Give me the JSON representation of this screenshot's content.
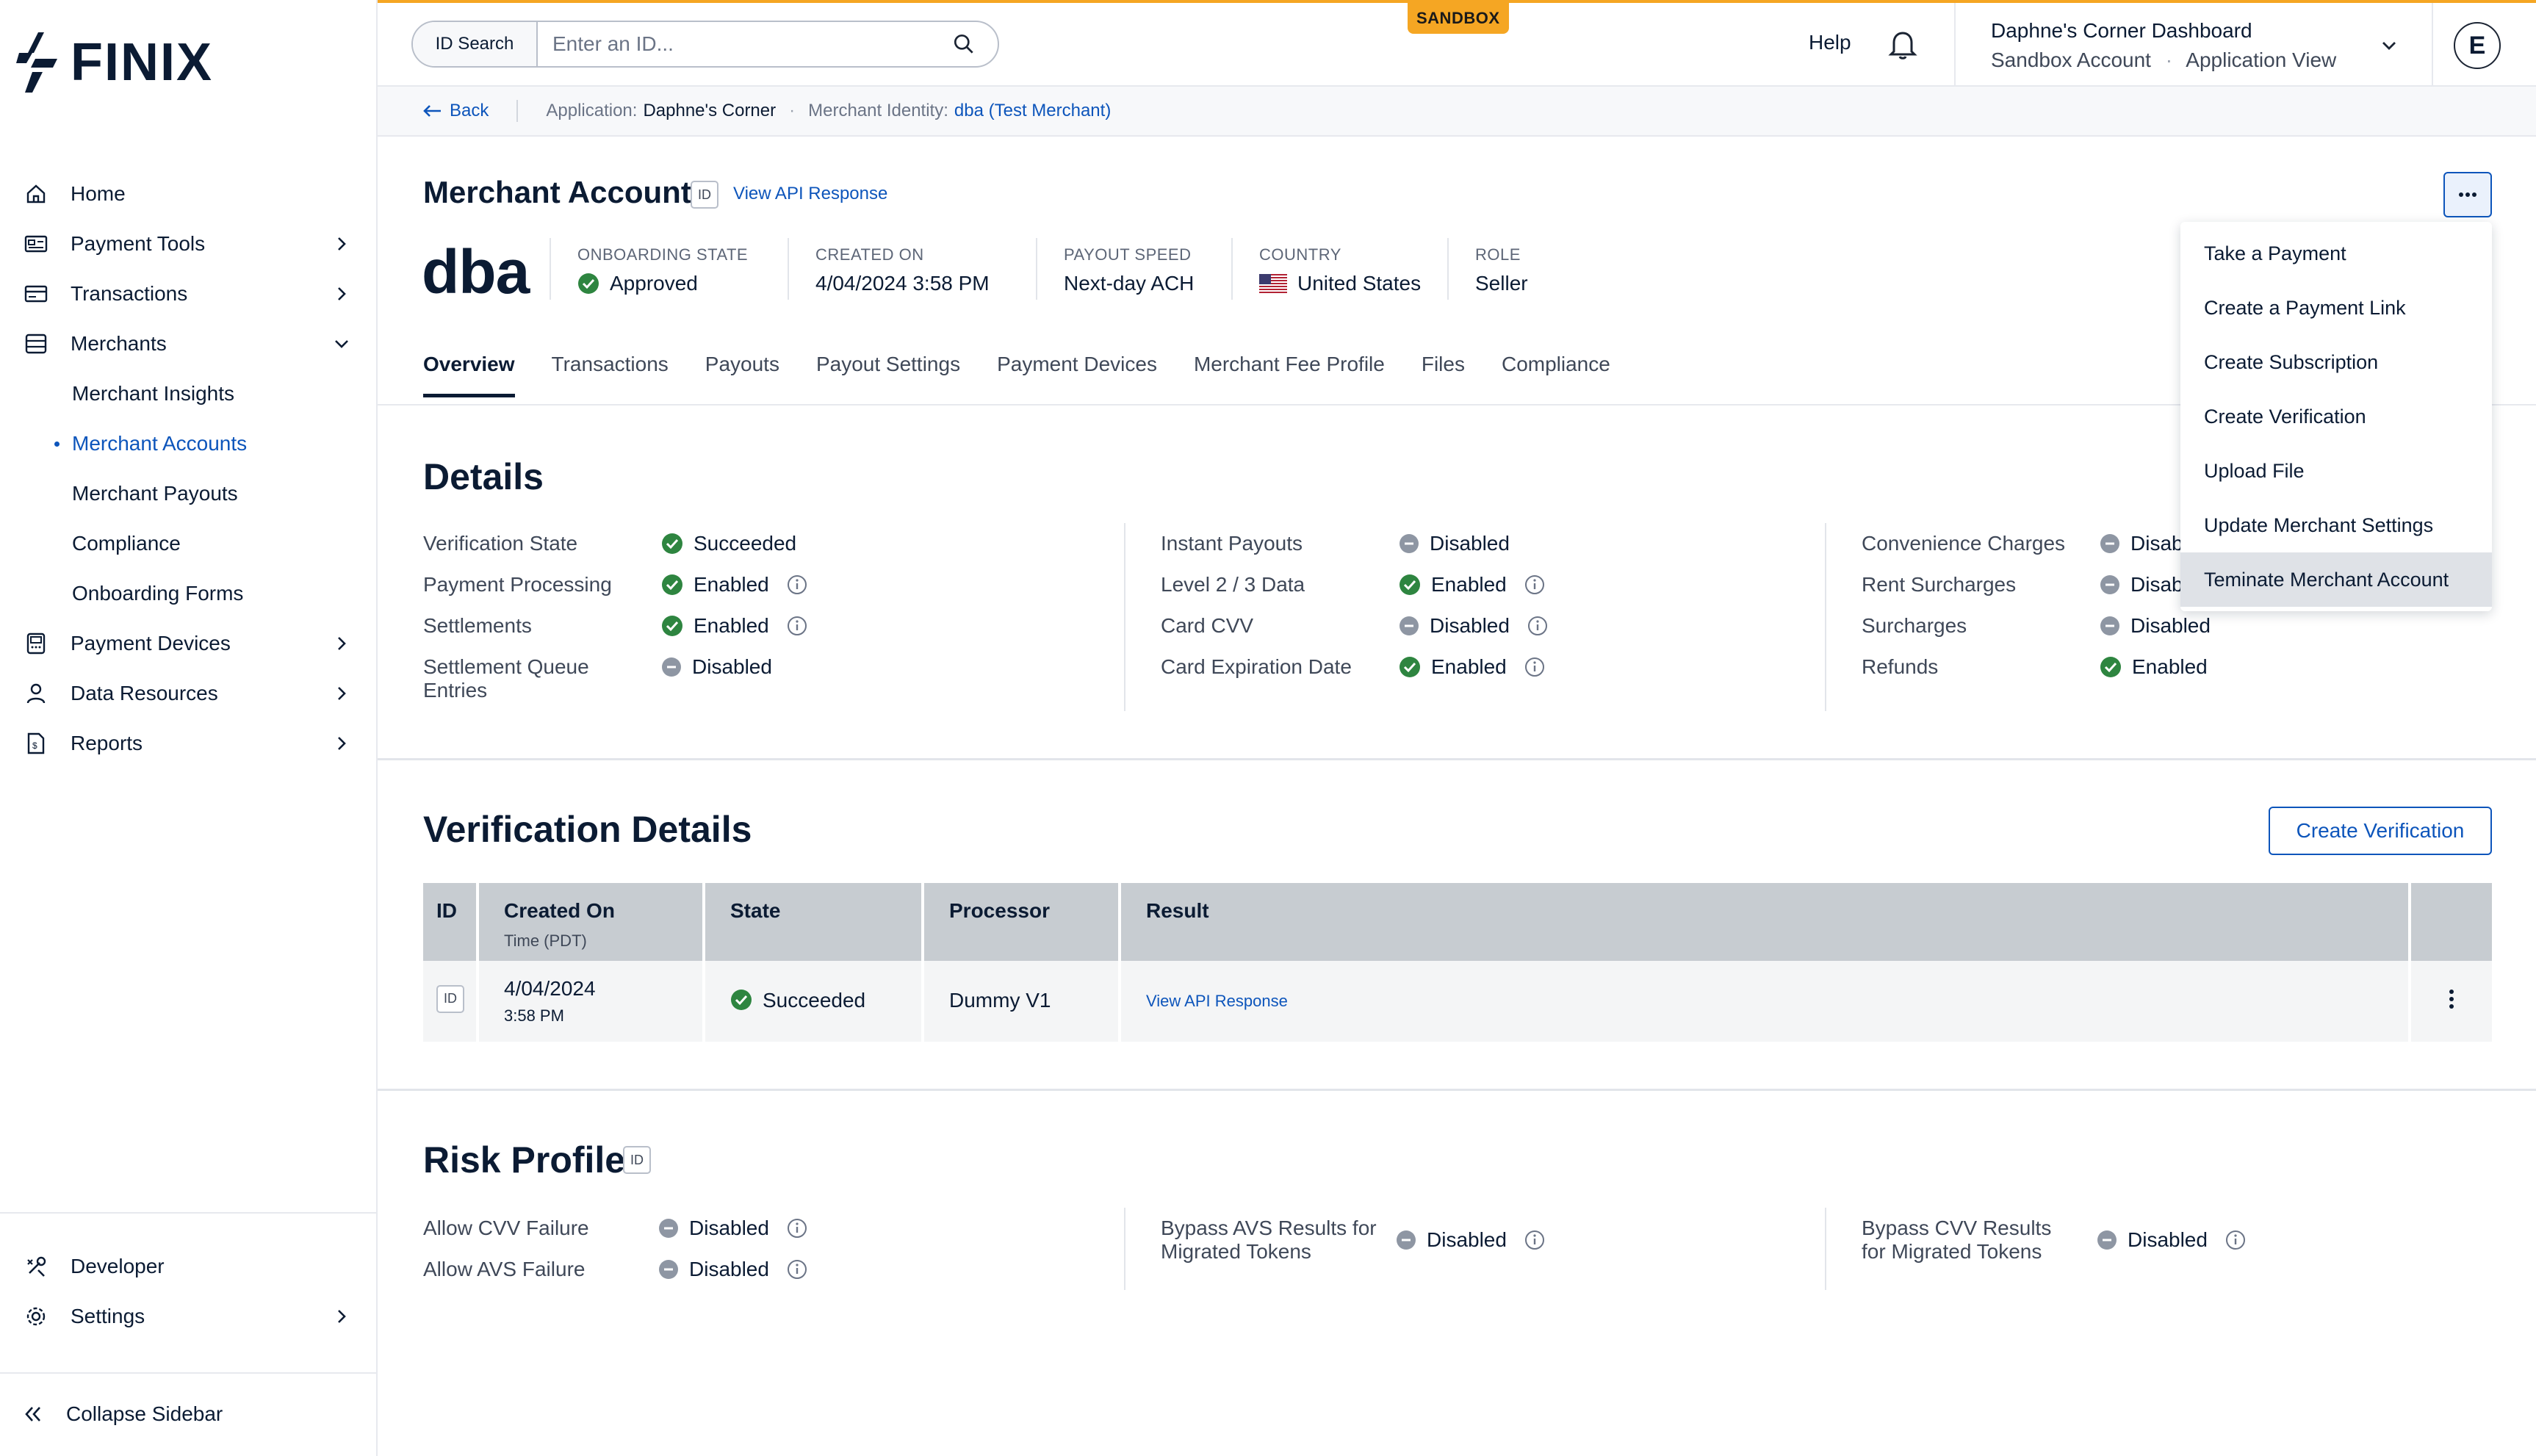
{
  "brand": {
    "name": "FINIX",
    "accent": "#0d55bb",
    "sandbox_color": "#f5a623"
  },
  "sidebar": {
    "items": [
      {
        "label": "Home",
        "icon": "home-icon"
      },
      {
        "label": "Payment Tools",
        "icon": "payment-tools-icon"
      },
      {
        "label": "Transactions",
        "icon": "transactions-icon"
      },
      {
        "label": "Merchants",
        "icon": "merchants-icon"
      },
      {
        "label": "Payment Devices",
        "icon": "payment-devices-icon"
      },
      {
        "label": "Data Resources",
        "icon": "data-resources-icon"
      },
      {
        "label": "Reports",
        "icon": "reports-icon"
      }
    ],
    "merchant_subitems": [
      "Merchant Insights",
      "Merchant Accounts",
      "Merchant Payouts",
      "Compliance",
      "Onboarding Forms"
    ],
    "active_subitem": "Merchant Accounts",
    "developer": "Developer",
    "settings": "Settings",
    "collapse": "Collapse Sidebar"
  },
  "topbar": {
    "sandbox_badge": "SANDBOX",
    "id_search_label": "ID Search",
    "id_search_placeholder": "Enter an ID...",
    "help": "Help",
    "dashboard_name": "Daphne's Corner Dashboard",
    "account_type": "Sandbox Account",
    "view_type": "Application View",
    "separator": "·",
    "avatar_initial": "E"
  },
  "breadcrumb": {
    "back": "Back",
    "application_label": "Application:",
    "application_value": "Daphne's Corner",
    "merchant_label": "Merchant Identity:",
    "merchant_value": "dba (Test Merchant)",
    "dot": "·"
  },
  "header": {
    "title": "Merchant Account",
    "id_chip": "ID",
    "view_api": "View API Response",
    "name": "dba",
    "meta": [
      {
        "label": "ONBOARDING STATE",
        "value": "Approved"
      },
      {
        "label": "CREATED ON",
        "value": "4/04/2024 3:58 PM"
      },
      {
        "label": "PAYOUT SPEED",
        "value": "Next-day ACH"
      },
      {
        "label": "COUNTRY",
        "value": "United States"
      },
      {
        "label": "ROLE",
        "value": "Seller"
      }
    ]
  },
  "tabs": [
    "Overview",
    "Transactions",
    "Payouts",
    "Payout Settings",
    "Payment Devices",
    "Merchant Fee Profile",
    "Files",
    "Compliance"
  ],
  "dropdown": {
    "items": [
      "Take a Payment",
      "Create a Payment Link",
      "Create Subscription",
      "Create Verification",
      "Upload File",
      "Update Merchant Settings",
      "Teminate Merchant Account"
    ]
  },
  "details": {
    "title": "Details",
    "col1": [
      {
        "label": "Verification State",
        "value": "Succeeded"
      },
      {
        "label": "Payment Processing",
        "value": "Enabled"
      },
      {
        "label": "Settlements",
        "value": "Enabled"
      },
      {
        "label": "Settlement Queue",
        "label2": "Entries",
        "value": "Disabled"
      }
    ],
    "col2": [
      {
        "label": "Instant Payouts",
        "value": "Disabled"
      },
      {
        "label": "Level 2 / 3 Data",
        "value": "Enabled"
      },
      {
        "label": "Card CVV",
        "value": "Disabled"
      },
      {
        "label": "Card Expiration Date",
        "value": "Enabled"
      }
    ],
    "col3": [
      {
        "label": "Convenience Charges",
        "value": "Disab"
      },
      {
        "label": "Rent Surcharges",
        "value": "Disab"
      },
      {
        "label": "Surcharges",
        "value": "Disabled"
      },
      {
        "label": "Refunds",
        "value": "Enabled"
      }
    ]
  },
  "verification": {
    "title": "Verification Details",
    "create_button": "Create Verification",
    "columns": [
      "ID",
      "Created On",
      "State",
      "Processor",
      "Result"
    ],
    "created_sub": "Time (PDT)",
    "row": {
      "id": "ID",
      "date": "4/04/2024",
      "time": "3:58 PM",
      "state": "Succeeded",
      "processor": "Dummy V1",
      "result": "View API Response"
    }
  },
  "risk": {
    "title": "Risk Profile",
    "id_chip": "ID",
    "col1": [
      {
        "label": "Allow CVV Failure",
        "value": "Disabled"
      },
      {
        "label": "Allow AVS Failure",
        "value": "Disabled"
      }
    ],
    "col2": {
      "label": "Bypass AVS Results for",
      "label2": "Migrated Tokens",
      "value": "Disabled"
    },
    "col3": {
      "label": "Bypass CVV Results",
      "label2": "for Migrated Tokens",
      "value": "Disabled"
    }
  }
}
